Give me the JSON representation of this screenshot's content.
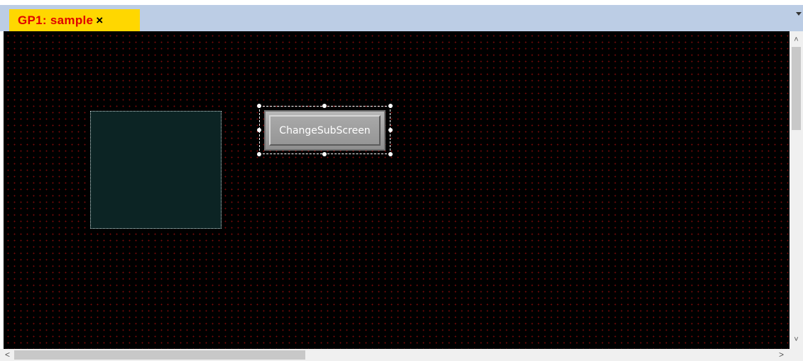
{
  "tab": {
    "title": "GP1: sample",
    "close_icon": "×"
  },
  "tab_menu_icon": "dropdown-arrow-icon",
  "canvas": {
    "background": "#000000",
    "grid_dot_color": "#7a0a0a",
    "button": {
      "label": "ChangeSubScreen"
    }
  },
  "scrollbars": {
    "up": "˄",
    "down": "˅",
    "left": "<",
    "right": ">"
  }
}
